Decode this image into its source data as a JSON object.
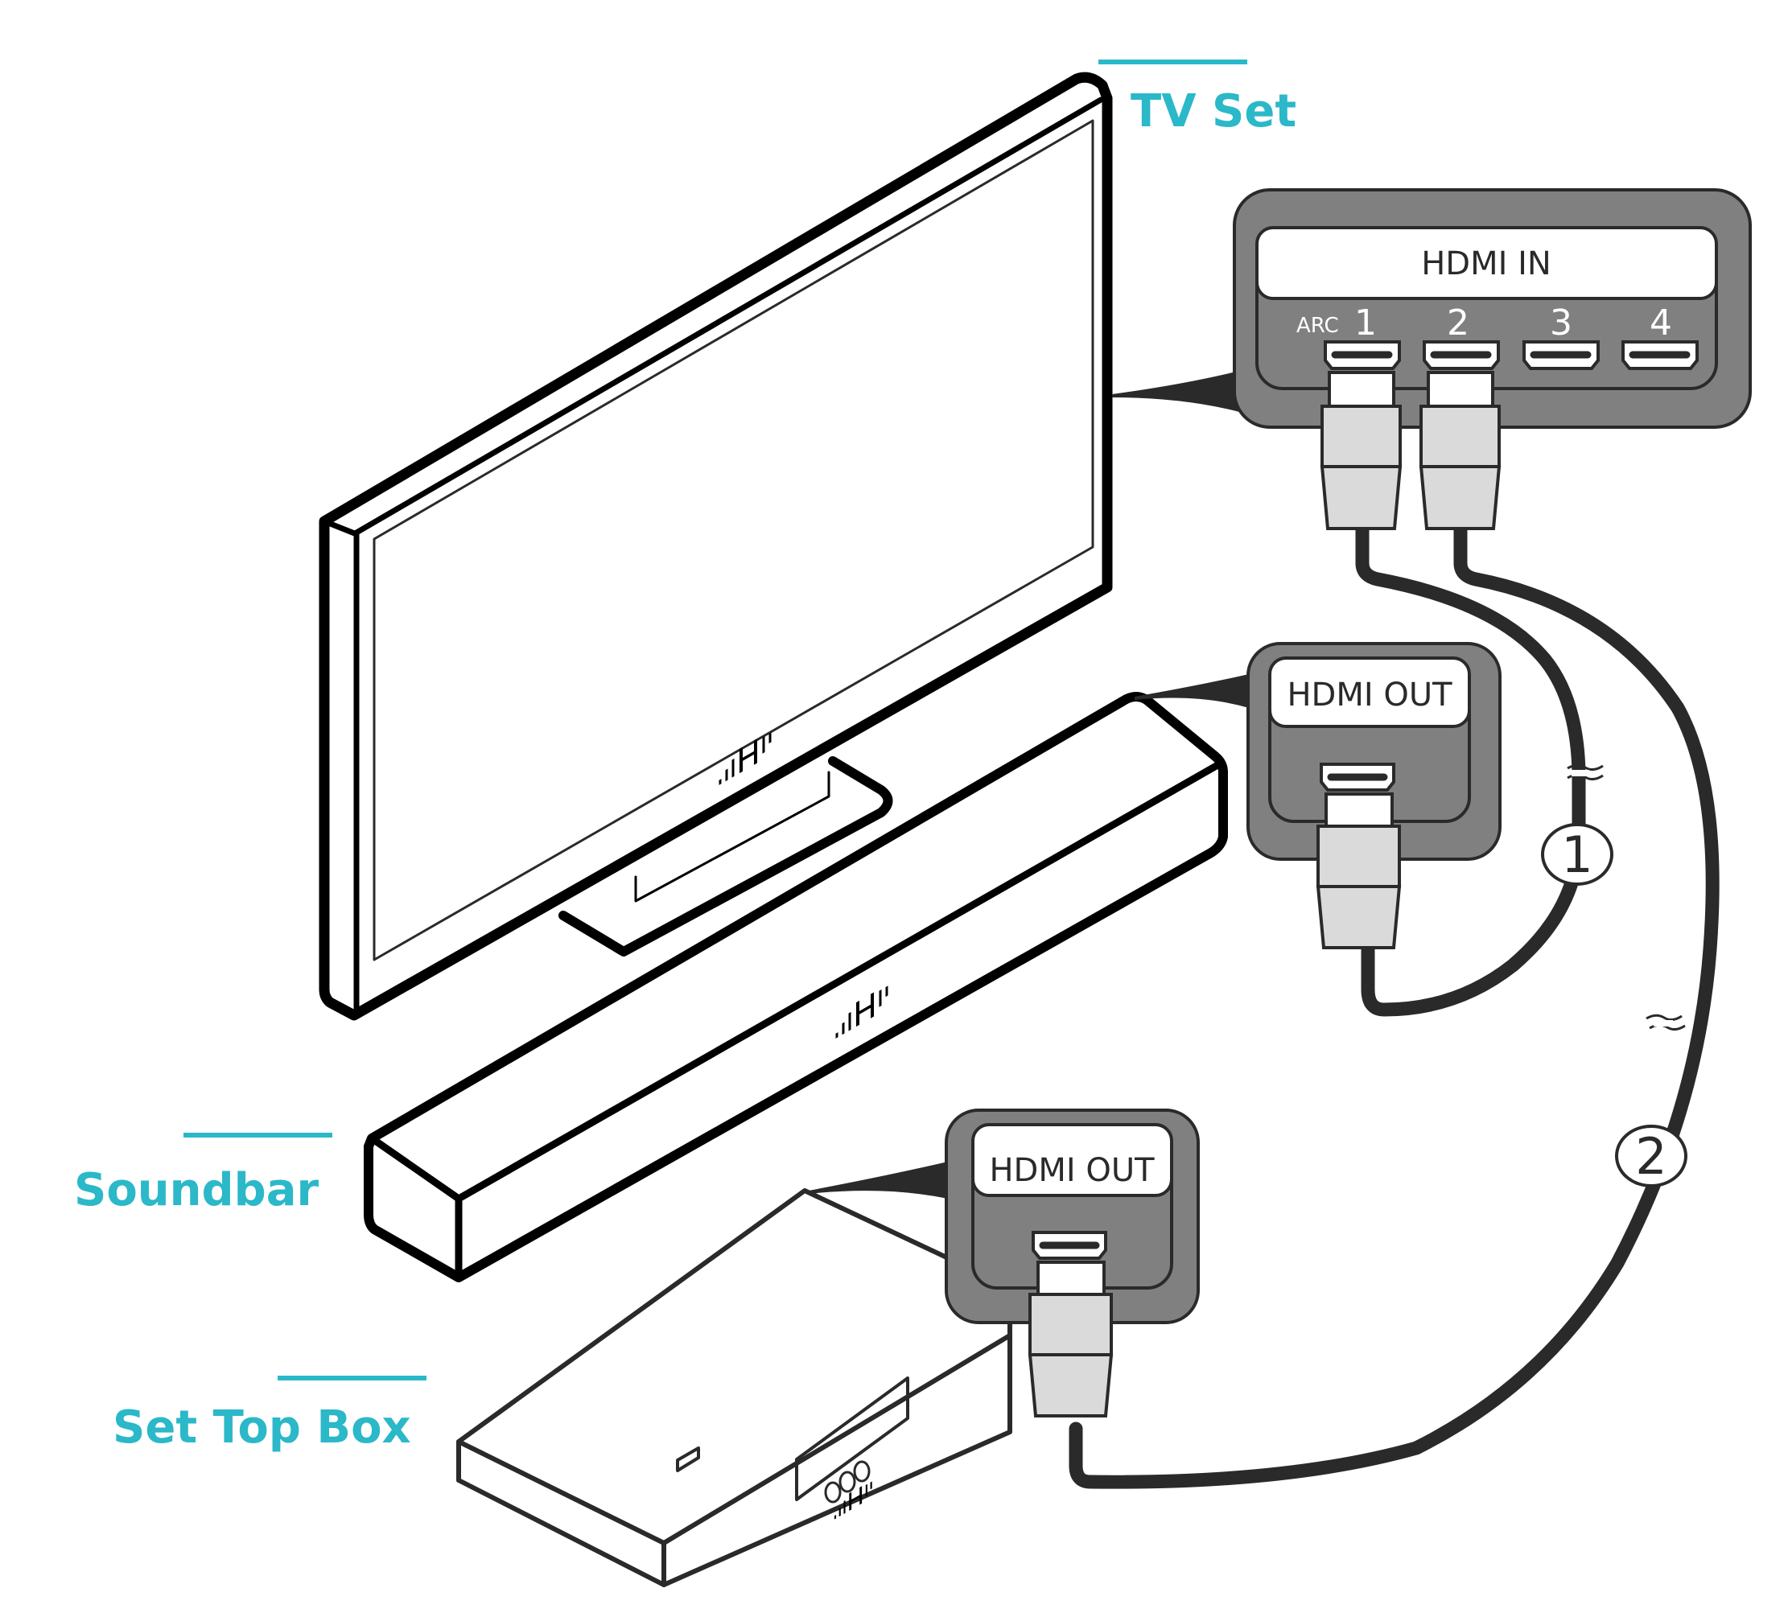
{
  "colors": {
    "accent": "#2bb8c8",
    "panel": "#808080",
    "plug": "#d9dad9",
    "line": "#2a2a2a"
  },
  "labels": {
    "tv": "TV Set",
    "soundbar": "Soundbar",
    "set_top_box": "Set Top Box"
  },
  "tv_panel": {
    "title": "HDMI IN",
    "arc_label": "ARC",
    "ports": [
      {
        "number": "1",
        "connected": true
      },
      {
        "number": "2",
        "connected": true
      },
      {
        "number": "3",
        "connected": false
      },
      {
        "number": "4",
        "connected": false
      }
    ]
  },
  "soundbar_panel": {
    "title": "HDMI OUT"
  },
  "stb_panel": {
    "title": "HDMI OUT"
  },
  "cables": [
    {
      "id": "1",
      "label": "1",
      "from": "Soundbar HDMI OUT",
      "to": "TV HDMI IN 1 (ARC)"
    },
    {
      "id": "2",
      "label": "2",
      "from": "Set Top Box HDMI OUT",
      "to": "TV HDMI IN 2"
    }
  ],
  "icons": {
    "brand_logo": "audio-bars-H-logo",
    "cable_break": "tilde-break-icon"
  }
}
